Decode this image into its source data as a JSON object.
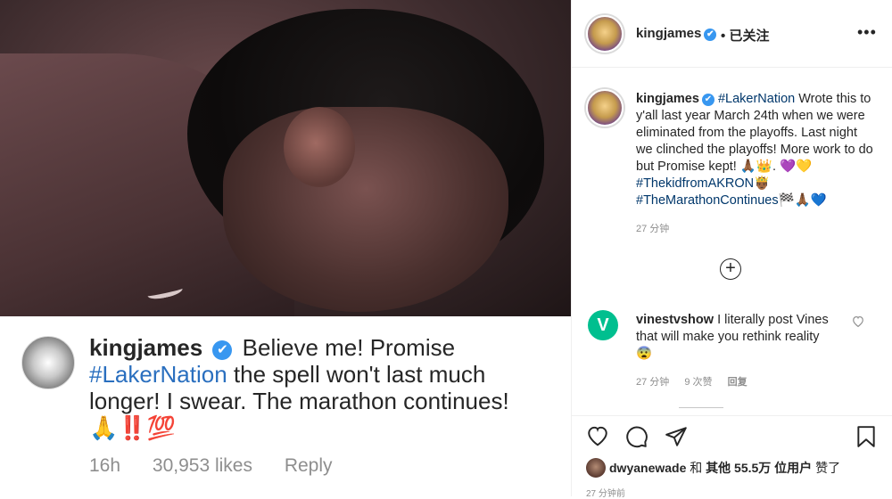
{
  "caption_card": {
    "username": "kingjames",
    "verified_mark": "✔",
    "text_lead": "Believe me! Promise",
    "hashtag": "#LakerNation",
    "text_tail": "the spell won't last much longer! I swear. The marathon continues!",
    "emojis": "🙏‼️💯",
    "time": "16h",
    "likes": "30,953 likes",
    "reply": "Reply"
  },
  "header": {
    "username": "kingjames",
    "verified_mark": "✔",
    "separator": "•",
    "follow_status": "已关注",
    "more_icon": "•••"
  },
  "post_comment": {
    "username": "kingjames",
    "verified_mark": "✔",
    "hashtag1": "#LakerNation",
    "text": "Wrote this to y'all last year March 24th when we were eliminated from the playoffs. Last night we clinched the playoffs! More work to do but Promise kept! 🙏🏾👑.",
    "emoji_line": "💜💛",
    "hashtag2": "#ThekidfromAKRON",
    "emoji_after2": "🤴🏾",
    "hashtag3": "#TheMarathonContinues",
    "emoji_after3": "🏁🙏🏾💙",
    "time": "27 分钟"
  },
  "load_more_icon": "+",
  "reply_comment": {
    "logo_letter": "V",
    "username": "vinestvshow",
    "text": "I literally post Vines that will make you rethink reality",
    "emoji": "😨",
    "time": "27 分钟",
    "likes": "9 次赞",
    "reply": "回复"
  },
  "likes_line": {
    "user": "dwyanewade",
    "connector": "和",
    "others": "其他 55.5万 位用户",
    "suffix": "赞了"
  },
  "time_ago": "27 分钟前",
  "colors": {
    "verified": "#3897f0",
    "hashtag": "#00376b",
    "vine": "#00bf8f"
  }
}
